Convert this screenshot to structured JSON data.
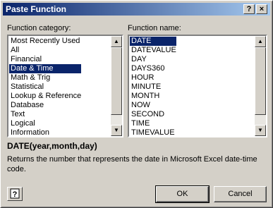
{
  "window": {
    "title": "Paste Function",
    "help_glyph": "?",
    "close_glyph": "×"
  },
  "category": {
    "label": "Function category:",
    "items": [
      "Most Recently Used",
      "All",
      "Financial",
      "Date & Time",
      "Math & Trig",
      "Statistical",
      "Lookup & Reference",
      "Database",
      "Text",
      "Logical",
      "Information"
    ],
    "selected": "Date & Time"
  },
  "functions": {
    "label": "Function name:",
    "items": [
      "DATE",
      "DATEVALUE",
      "DAY",
      "DAYS360",
      "HOUR",
      "MINUTE",
      "MONTH",
      "NOW",
      "SECOND",
      "TIME",
      "TIMEVALUE"
    ],
    "selected": "DATE"
  },
  "syntax": "DATE(year,month,day)",
  "description": "Returns the number that represents the date in Microsoft Excel date-time code.",
  "buttons": {
    "ok": "OK",
    "cancel": "Cancel"
  },
  "icons": {
    "help": "help-icon",
    "scroll_up": "▲",
    "scroll_down": "▼"
  },
  "colors": {
    "selection": "#0a246a",
    "face": "#d4d0c8"
  }
}
